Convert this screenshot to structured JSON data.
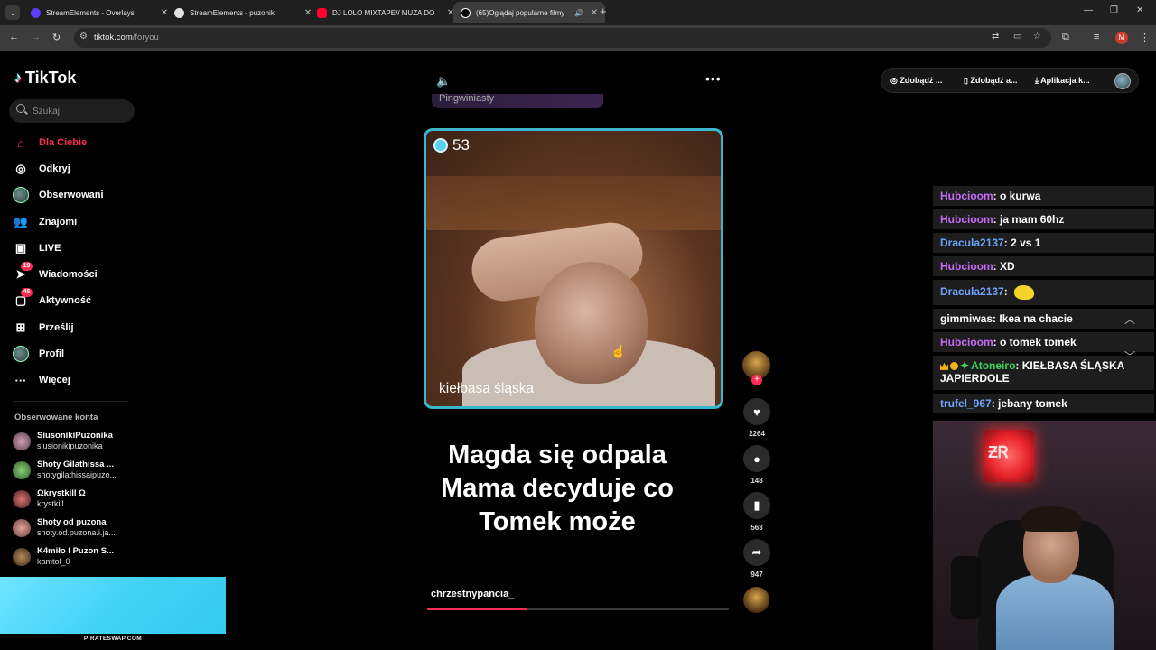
{
  "browser": {
    "tabs": [
      {
        "title": "StreamElements - Overlays",
        "favicon_color": "#5b3df5",
        "active": false
      },
      {
        "title": "StreamElements - puzonik",
        "favicon_color": "#e0e0e0",
        "active": false
      },
      {
        "title": "DJ LOLO MIXTAPE// MUZA DO",
        "favicon_color": "#ff0033",
        "active": false
      },
      {
        "title": "(65)Oglądaj popularne filmy",
        "favicon_color": "#ffffff",
        "active": true
      }
    ],
    "url_host": "tiktok.com",
    "url_path": "/foryou",
    "profile_initial": "M"
  },
  "tiktok": {
    "logo": "TikTok",
    "search_placeholder": "Szukaj",
    "nav": [
      {
        "label": "Dla Ciebie",
        "icon": "home-icon",
        "active": true
      },
      {
        "label": "Odkryj",
        "icon": "compass-icon"
      },
      {
        "label": "Obserwowani",
        "icon": "avatar-icon"
      },
      {
        "label": "Znajomi",
        "icon": "friends-icon"
      },
      {
        "label": "LIVE",
        "icon": "live-icon"
      },
      {
        "label": "Wiadomości",
        "icon": "messages-icon",
        "badge": "19"
      },
      {
        "label": "Aktywność",
        "icon": "activity-icon",
        "badge": "46"
      },
      {
        "label": "Prześlij",
        "icon": "upload-icon"
      },
      {
        "label": "Profil",
        "icon": "profile-icon"
      },
      {
        "label": "Więcej",
        "icon": "more-icon"
      }
    ],
    "followed_title": "Obserwowane konta",
    "followed": [
      {
        "name": "SiusonikiPuzonika",
        "user": "siusionikipuzonika"
      },
      {
        "name": "Shoty Gilathissa ...",
        "user": "shotygilathissaipuzo..."
      },
      {
        "name": "Ωkrystkill Ω",
        "user": "krystkill"
      },
      {
        "name": "Shoty od puzona",
        "user": "shoty.od.puzona.i.ja..."
      },
      {
        "name": "K4miło I Puzon S...",
        "user": "kamtol_0"
      }
    ],
    "top_buttons": [
      "Zdobądź ...",
      "Zdobądź a...",
      "Aplikacja k..."
    ],
    "video": {
      "prev_text": "Pingwiniasty",
      "viewer_count": "53",
      "frame_caption": "kiełbasa śląska",
      "caption_lines": [
        "Magda się  odpala",
        "Mama decyduje co",
        "Tomek może"
      ],
      "author": "chrzestnypancia_",
      "progress": 0.33,
      "likes": "2264",
      "comments": "148",
      "saves": "563",
      "shares": "947"
    }
  },
  "chat": [
    {
      "user": "Hubcioom",
      "text": "o kurwa",
      "color": "purple"
    },
    {
      "user": "Hubcioom",
      "text": "ja mam 60hz",
      "color": "purple"
    },
    {
      "user": "Dracula2137",
      "text": "2 vs 1",
      "color": "blue"
    },
    {
      "user": "Hubcioom",
      "text": "XD",
      "color": "purple"
    },
    {
      "user": "Dracula2137",
      "text": "",
      "color": "blue",
      "emote": true
    },
    {
      "user": "gimmiwas",
      "text": "Ikea na chacie",
      "color": "white"
    },
    {
      "user": "Hubcioom",
      "text": "o tomek tomek",
      "color": "purple"
    },
    {
      "user": "Atoneiro",
      "text": "KIEŁBASA ŚLĄSKA JAPIERDOLE",
      "color": "green",
      "badges": true
    },
    {
      "user": "trufel_967",
      "text": "jebany tomek",
      "color": "blue"
    }
  ],
  "overlay_label": "PIRATESWAP.COM"
}
